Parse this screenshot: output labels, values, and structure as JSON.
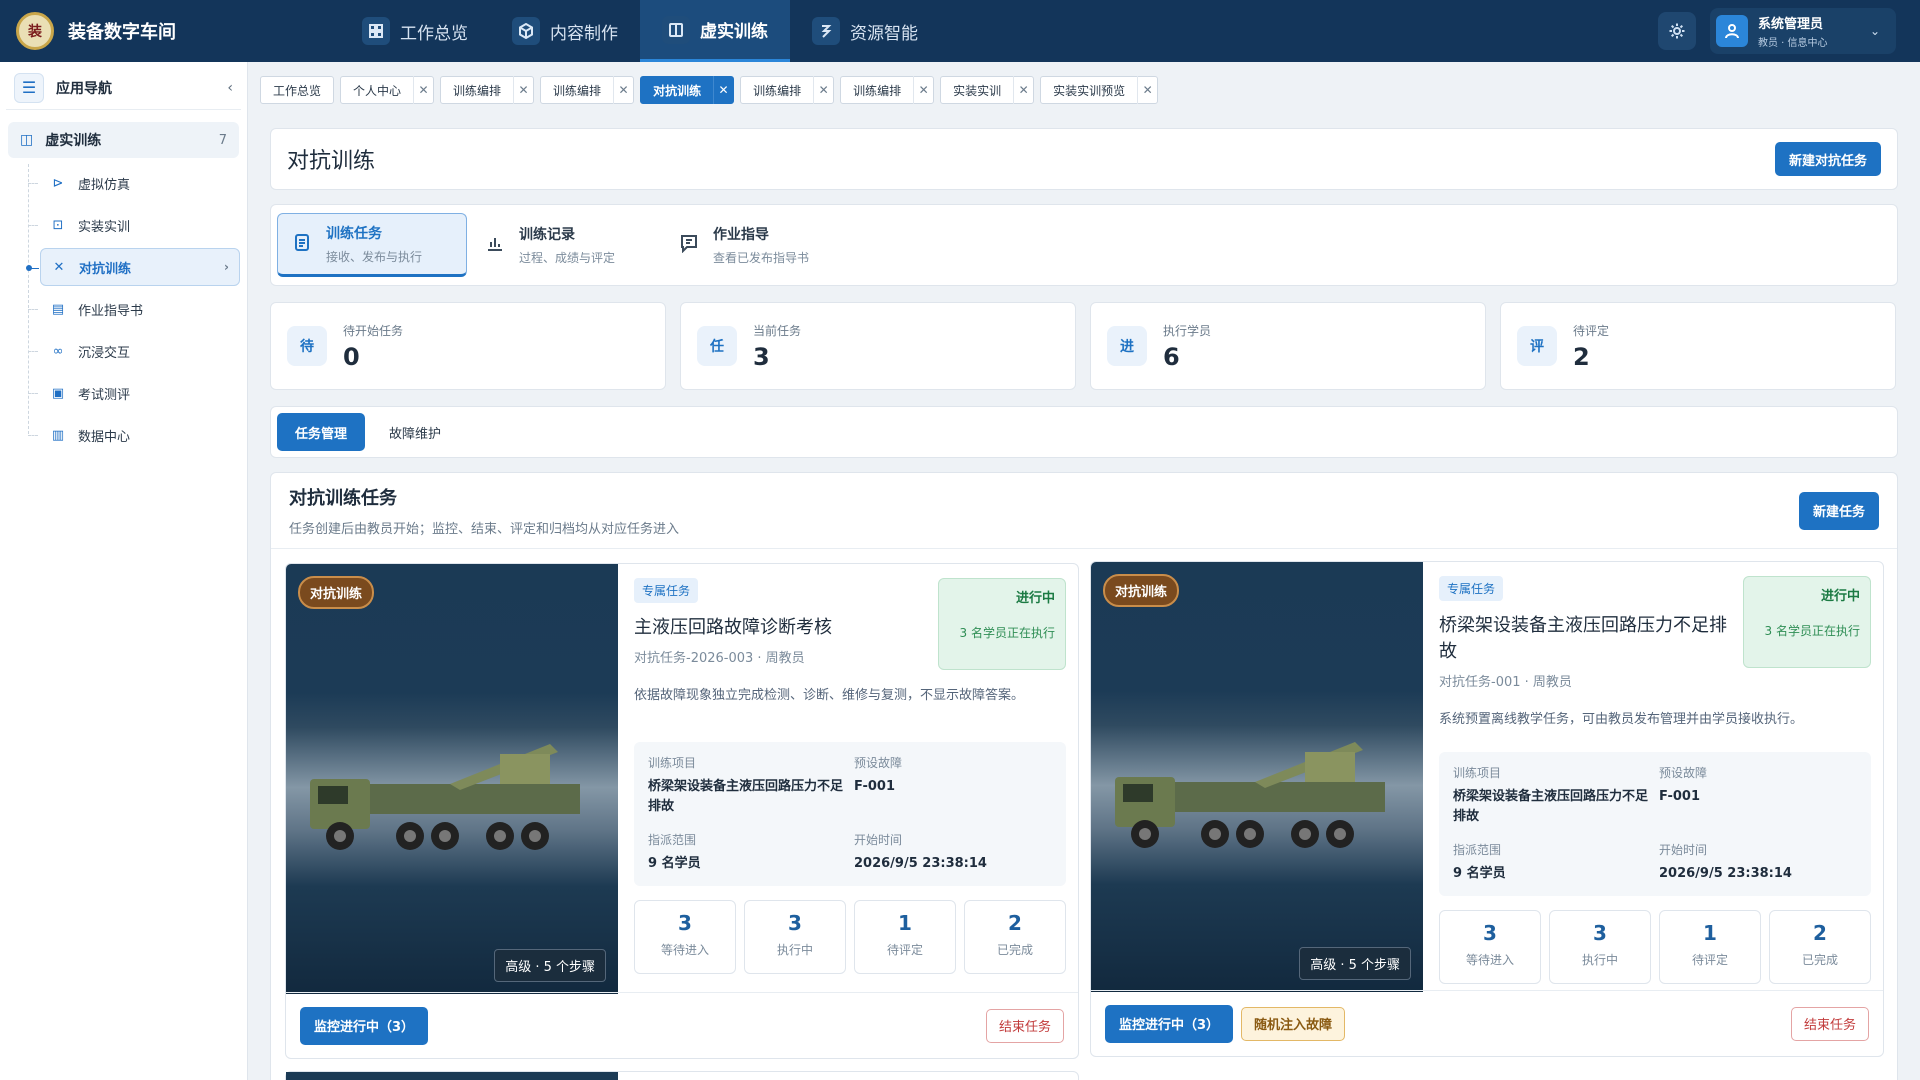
{
  "app": {
    "title": "装备数字车间",
    "emblem_text": "装"
  },
  "topnav": [
    {
      "label": "工作总览",
      "icon": "grid-icon",
      "active": false
    },
    {
      "label": "内容制作",
      "icon": "box-icon",
      "active": false
    },
    {
      "label": "虚实训练",
      "icon": "book-icon",
      "active": true
    },
    {
      "label": "资源智能",
      "icon": "plug-icon",
      "active": false
    }
  ],
  "user": {
    "name": "系统管理员",
    "role": "教员 · 信息中心"
  },
  "sidebar": {
    "header": "应用导航",
    "group": {
      "label": "虚实训练",
      "count": "7"
    },
    "items": [
      {
        "label": "虚拟仿真",
        "icon": "play-icon"
      },
      {
        "label": "实装实训",
        "icon": "monitor-icon"
      },
      {
        "label": "对抗训练",
        "icon": "cross-swords-icon"
      },
      {
        "label": "作业指导书",
        "icon": "document-icon"
      },
      {
        "label": "沉浸交互",
        "icon": "vr-icon"
      },
      {
        "label": "考试测评",
        "icon": "clipboard-icon"
      },
      {
        "label": "数据中心",
        "icon": "chart-icon"
      }
    ]
  },
  "tabs": [
    {
      "label": "工作总览",
      "closable": false
    },
    {
      "label": "个人中心",
      "closable": true
    },
    {
      "label": "训练编排",
      "closable": true
    },
    {
      "label": "训练编排",
      "closable": true
    },
    {
      "label": "对抗训练",
      "closable": true,
      "active": true
    },
    {
      "label": "训练编排",
      "closable": true
    },
    {
      "label": "训练编排",
      "closable": true
    },
    {
      "label": "实装实训",
      "closable": true
    },
    {
      "label": "实装实训预览",
      "closable": true
    }
  ],
  "page": {
    "title": "对抗训练",
    "new_button": "新建对抗任务"
  },
  "subtabs": [
    {
      "title": "训练任务",
      "desc": "接收、发布与执行"
    },
    {
      "title": "训练记录",
      "desc": "过程、成绩与评定"
    },
    {
      "title": "作业指导",
      "desc": "查看已发布指导书"
    }
  ],
  "stats": [
    {
      "icon_text": "待",
      "label": "待开始任务",
      "value": "0"
    },
    {
      "icon_text": "任",
      "label": "当前任务",
      "value": "3"
    },
    {
      "icon_text": "进",
      "label": "执行学员",
      "value": "6"
    },
    {
      "icon_text": "评",
      "label": "待评定",
      "value": "2"
    }
  ],
  "segments": {
    "task_mgmt": "任务管理",
    "fault_maint": "故障维护"
  },
  "tasks_section": {
    "title": "对抗训练任务",
    "subtitle": "任务创建后由教员开始；监控、结束、评定和归档均从对应任务进入",
    "new_button": "新建任务"
  },
  "task_cards": [
    {
      "badge": "对抗训练",
      "level": "高级 · 5 个步骤",
      "tag": "专属任务",
      "name": "主液压回路故障诊断考核",
      "code": "对抗任务-2026-003 · 周教员",
      "status": "进行中",
      "status_desc": "3 名学员正在执行",
      "desc": "依据故障现象独立完成检测、诊断、维修与复测，不显示故障答案。",
      "info": {
        "project_label": "训练项目",
        "project": "桥梁架设装备主液压回路压力不足排故",
        "fault_label": "预设故障",
        "fault": "F-001",
        "scope_label": "指派范围",
        "scope": "9 名学员",
        "start_label": "开始时间",
        "start": "2026/9/5 23:38:14"
      },
      "mini": [
        {
          "value": "3",
          "label": "等待进入"
        },
        {
          "value": "3",
          "label": "执行中"
        },
        {
          "value": "1",
          "label": "待评定"
        },
        {
          "value": "2",
          "label": "已完成"
        }
      ],
      "monitor": "监控进行中（3）",
      "end": "结束任务"
    },
    {
      "badge": "对抗训练",
      "level": "高级 · 5 个步骤",
      "tag": "专属任务",
      "name": "桥梁架设装备主液压回路压力不足排故",
      "code": "对抗任务-001 · 周教员",
      "status": "进行中",
      "status_desc": "3 名学员正在执行",
      "desc": "系统预置离线教学任务，可由教员发布管理并由学员接收执行。",
      "info": {
        "project_label": "训练项目",
        "project": "桥梁架设装备主液压回路压力不足排故",
        "fault_label": "预设故障",
        "fault": "F-001",
        "scope_label": "指派范围",
        "scope": "9 名学员",
        "start_label": "开始时间",
        "start": "2026/9/5 23:38:14"
      },
      "mini": [
        {
          "value": "3",
          "label": "等待进入"
        },
        {
          "value": "3",
          "label": "执行中"
        },
        {
          "value": "1",
          "label": "待评定"
        },
        {
          "value": "2",
          "label": "已完成"
        }
      ],
      "monitor": "监控进行中（3）",
      "inject": "随机注入故障",
      "end": "结束任务"
    }
  ],
  "colors": {
    "topbar": "#13355a",
    "accent": "#1e72c3",
    "success": "#1b7a43",
    "danger": "#c23b3b",
    "badge": "#7a4a1e"
  }
}
